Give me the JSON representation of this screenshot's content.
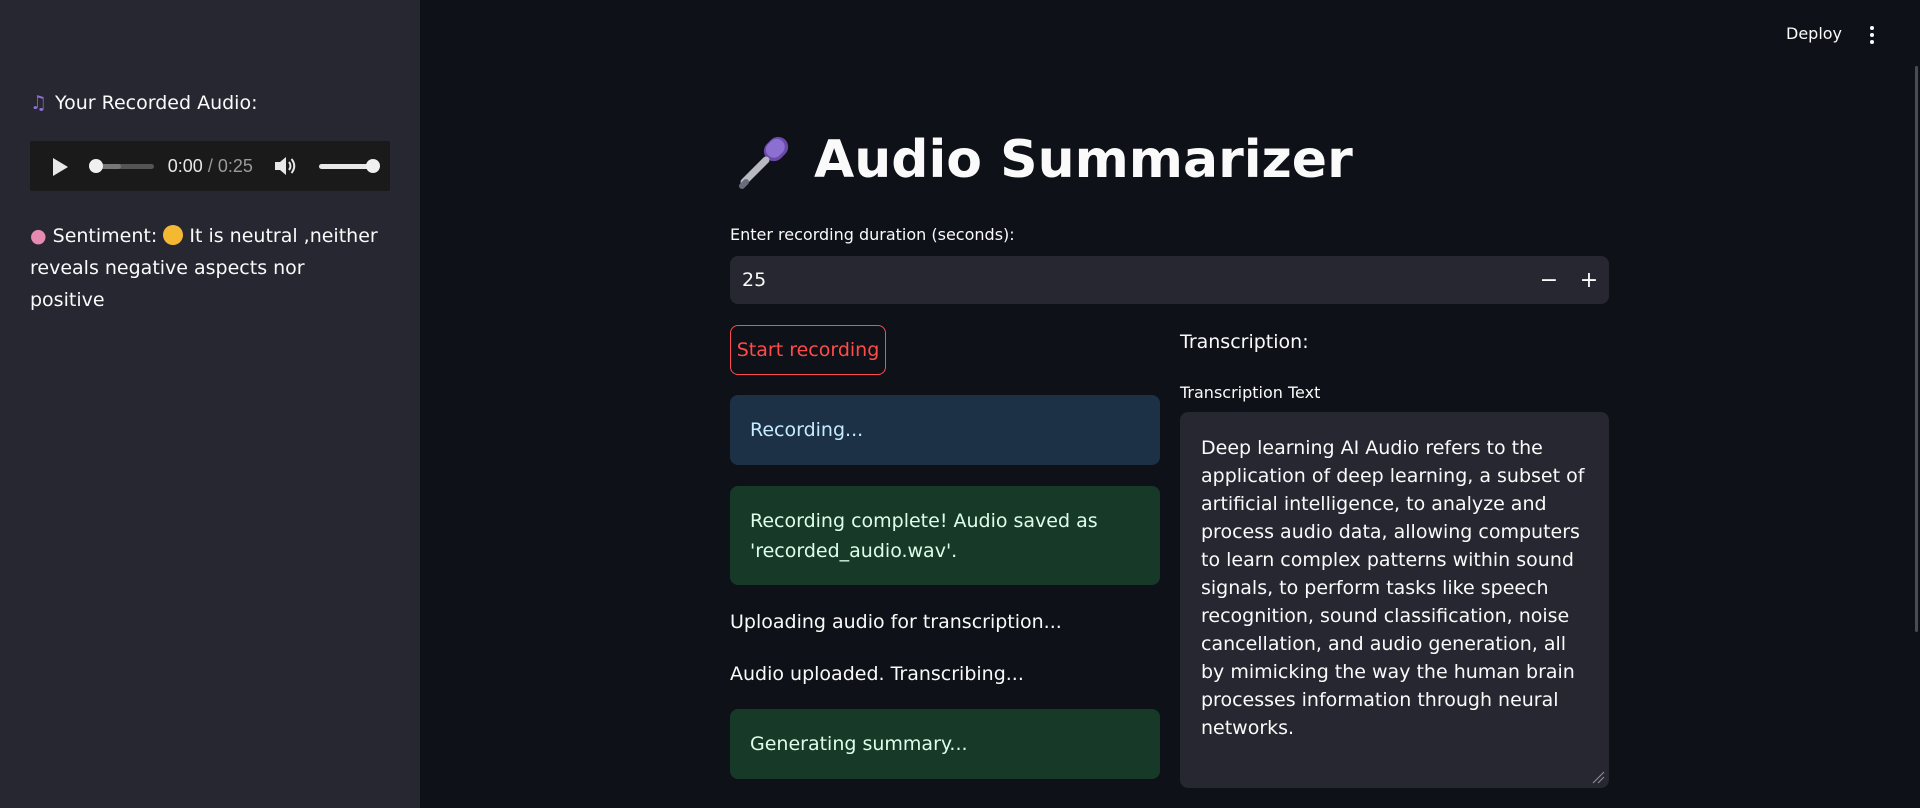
{
  "header": {
    "deploy_label": "Deploy",
    "menu_icon": "more-vertical-icon"
  },
  "sidebar": {
    "recorded_heading": "Your Recorded Audio:",
    "heading_icon": "music-notes-icon",
    "audio": {
      "current_time": "0:00",
      "separator": " / ",
      "duration": "0:25",
      "progress": 0,
      "volume": 1.0
    },
    "sentiment_label": "Sentiment:",
    "sentiment_icon": "brain-icon",
    "sentiment_face_icon": "neutral-face-icon",
    "sentiment_text_line1": "It is neutral ,neither",
    "sentiment_text_line2": "reveals negative aspects nor positive"
  },
  "main": {
    "title": "Audio Summarizer",
    "title_icon": "microphone-icon",
    "duration_label": "Enter recording duration (seconds):",
    "duration_value": "25",
    "decrement_label": "−",
    "increment_label": "+",
    "start_button": "Start recording",
    "info_recording": "Recording...",
    "success_complete_line1": "Recording complete! Audio saved as",
    "success_complete_line2": "'recorded_audio.wav'.",
    "uploading_text": "Uploading audio for transcription...",
    "transcribing_text": "Audio uploaded. Transcribing...",
    "summary_text": "Generating summary...",
    "transcription_heading": "Transcription:",
    "transcription_label": "Transcription Text",
    "transcription_value": "Deep learning AI Audio refers to the application of deep learning, a subset of artificial intelligence, to analyze and process audio data, allowing computers to learn complex patterns within sound signals, to perform tasks like speech recognition, sound classification, noise cancellation, and audio generation, all by mimicking the way the human brain processes information through neural networks."
  },
  "colors": {
    "background": "#0e1117",
    "sidebar": "#262730",
    "accent": "#ff4b4b",
    "info_bg": "#1c3046",
    "success_bg": "#173928"
  }
}
